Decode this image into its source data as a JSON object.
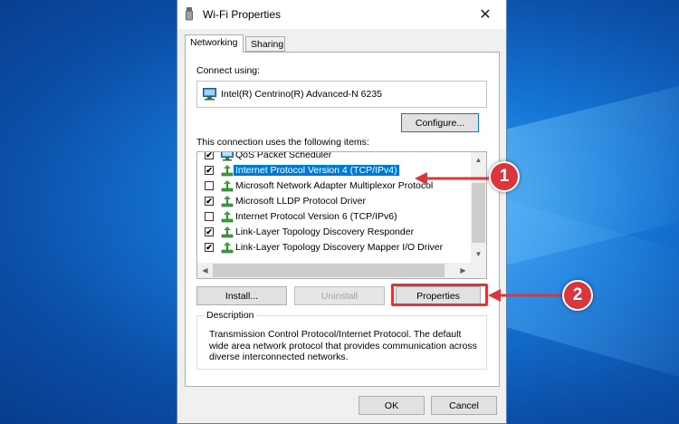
{
  "window": {
    "title": "Wi-Fi Properties",
    "close_symbol": "✕"
  },
  "tabs": [
    {
      "label": "Networking",
      "active": true
    },
    {
      "label": "Sharing",
      "active": false
    }
  ],
  "connect": {
    "label": "Connect using:",
    "adapter": "Intel(R) Centrino(R) Advanced-N 6235",
    "configure_label": "Configure..."
  },
  "items_section": {
    "label": "This connection uses the following items:",
    "items": [
      {
        "label": "QoS Packet Scheduler",
        "checked": true,
        "icon": "network-service-icon"
      },
      {
        "label": "Internet Protocol Version 4 (TCP/IPv4)",
        "checked": true,
        "selected": true,
        "icon": "network-protocol-icon"
      },
      {
        "label": "Microsoft Network Adapter Multiplexor Protocol",
        "checked": false,
        "icon": "network-protocol-icon"
      },
      {
        "label": "Microsoft LLDP Protocol Driver",
        "checked": true,
        "icon": "network-protocol-icon"
      },
      {
        "label": "Internet Protocol Version 6 (TCP/IPv6)",
        "checked": false,
        "icon": "network-protocol-icon"
      },
      {
        "label": "Link-Layer Topology Discovery Responder",
        "checked": true,
        "icon": "network-protocol-icon"
      },
      {
        "label": "Link-Layer Topology Discovery Mapper I/O Driver",
        "checked": true,
        "icon": "network-protocol-icon"
      }
    ],
    "check_glyph": "✔"
  },
  "buttons": {
    "install": "Install...",
    "uninstall": "Uninstall",
    "properties": "Properties",
    "ok": "OK",
    "cancel": "Cancel"
  },
  "description": {
    "label": "Description",
    "text": "Transmission Control Protocol/Internet Protocol. The default wide area network protocol that provides communication across diverse interconnected networks."
  },
  "annotations": {
    "marker1": "1",
    "marker2": "2",
    "accent_color": "#d9363e"
  },
  "colors": {
    "selection": "#0078d7",
    "dialog_bg": "#f0f0f0",
    "desktop_blue": "#1677d6"
  }
}
